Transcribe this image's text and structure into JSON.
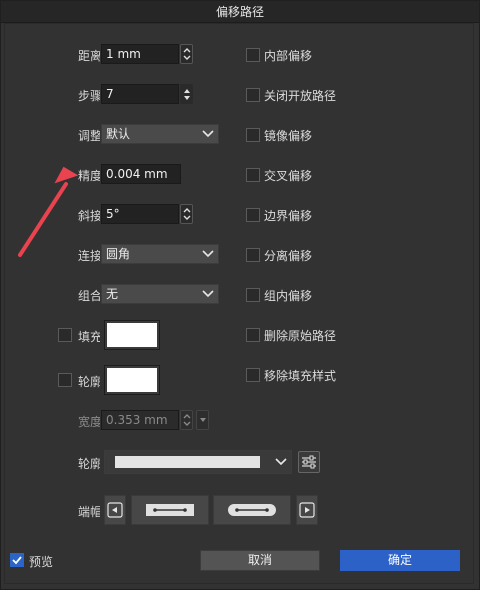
{
  "window": {
    "title": "偏移路径"
  },
  "fields": {
    "distance": {
      "label": "距离",
      "value": "1 mm"
    },
    "steps": {
      "label": "步骤",
      "value": "7"
    },
    "adjust": {
      "label": "调整",
      "value": "默认"
    },
    "precision": {
      "label": "精度",
      "value": "0.004 mm"
    },
    "miter": {
      "label": "斜接",
      "value": "5°"
    },
    "join": {
      "label": "连接",
      "value": "圆角"
    },
    "combine": {
      "label": "组合",
      "value": "无"
    },
    "fill": {
      "label": "填充"
    },
    "stroke": {
      "label": "轮廓"
    },
    "width": {
      "label": "宽度",
      "value": "0.353 mm"
    },
    "stroke_style": {
      "label": "轮廓"
    },
    "caps": {
      "label": "端帽"
    }
  },
  "options": [
    {
      "label": "内部偏移",
      "checked": false
    },
    {
      "label": "关闭开放路径",
      "checked": false
    },
    {
      "label": "镜像偏移",
      "checked": false
    },
    {
      "label": "交叉偏移",
      "checked": false
    },
    {
      "label": "边界偏移",
      "checked": false
    },
    {
      "label": "分离偏移",
      "checked": false
    },
    {
      "label": "组内偏移",
      "checked": false
    },
    {
      "label": "删除原始路径",
      "checked": false
    },
    {
      "label": "移除填充样式",
      "checked": false
    }
  ],
  "footer": {
    "preview": {
      "label": "预览",
      "checked": true
    },
    "cancel": "取消",
    "ok": "确定"
  },
  "annotation": {
    "color": "#e8434f",
    "shape": "arrow",
    "target": "精度"
  },
  "colors": {
    "accent": "#2c62c8",
    "swatch": "#ffffff"
  }
}
